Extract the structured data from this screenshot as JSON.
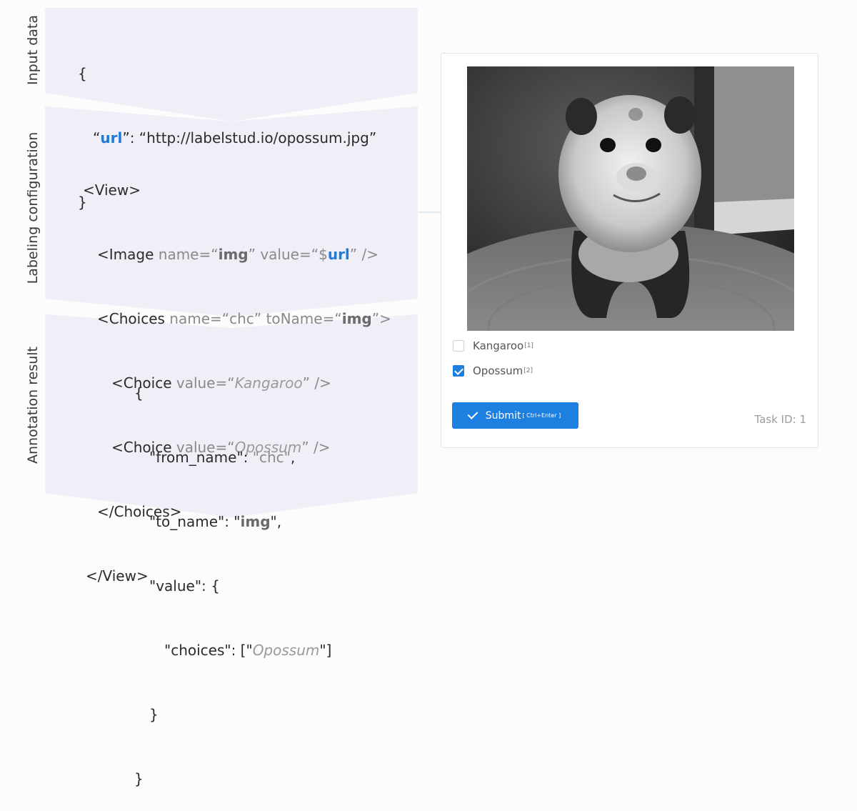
{
  "sections": {
    "input": {
      "label": "Input data"
    },
    "config": {
      "label": "Labeling configuration"
    },
    "result": {
      "label": "Annotation result"
    }
  },
  "input_code": {
    "open": "{",
    "q1": "“",
    "key": "url",
    "sep": "”: “",
    "value": "http://labelstud.io/opossum.jpg",
    "q2": "”",
    "close": "}"
  },
  "config_code": {
    "l1": "<View>",
    "l2": {
      "a": "<Image ",
      "b": "name=“",
      "c": "img",
      "d": "” value=“$",
      "e": "url",
      "f": "” />"
    },
    "l3": {
      "a": "<Choices ",
      "b": "name=“chc” toName=“",
      "c": "img",
      "d": "”>"
    },
    "l4": {
      "a": "<Choice ",
      "b": "value=“",
      "c": "Kangaroo",
      "d": "” />"
    },
    "l5": {
      "a": "<Choice ",
      "b": "value=“",
      "c": "Opossum",
      "d": "” />"
    },
    "l6": "</Choices>",
    "l7": "</View>"
  },
  "result_code": {
    "l1": "{",
    "l2": {
      "a": "\"from_name\": ",
      "b": "\"chc\"",
      "c": ","
    },
    "l3": {
      "a": "\"to_name\": \"",
      "b": "img",
      "c": "\","
    },
    "l4": "\"value\": {",
    "l5": {
      "a": "\"choices\": [\"",
      "b": "Opossum",
      "c": "\"]"
    },
    "l6": "}",
    "l7": "}"
  },
  "ui": {
    "choices": [
      {
        "label": "Kangaroo",
        "hotkey": "[1]",
        "checked": false
      },
      {
        "label": "Opossum",
        "hotkey": "[2]",
        "checked": true
      }
    ],
    "submit_label": "Submit",
    "submit_shortcut": "[ Ctrl+Enter ]",
    "task_id": "Task ID: 1"
  },
  "colors": {
    "panel": "#f0eef6",
    "accent": "#1d7fe0",
    "code_key": "#1f7ad8"
  }
}
